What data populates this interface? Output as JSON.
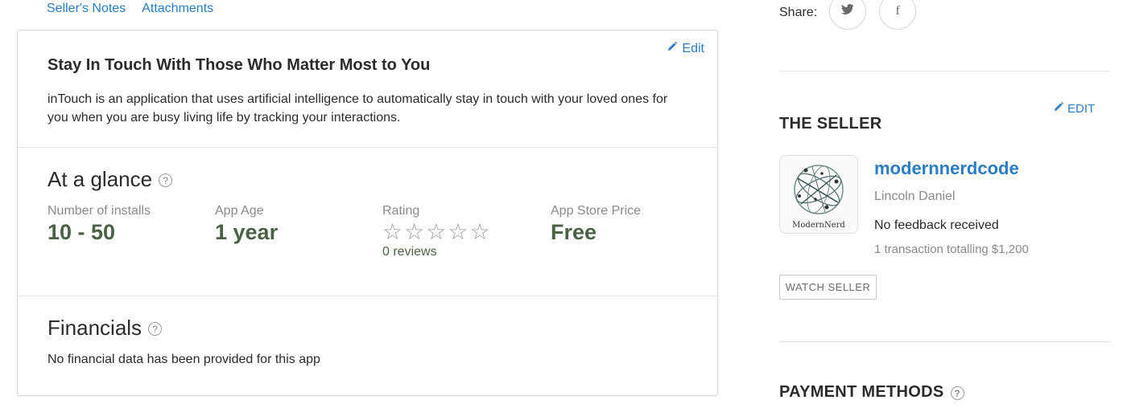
{
  "tabs": [
    {
      "label": "Seller's Notes"
    },
    {
      "label": "Attachments"
    }
  ],
  "about": {
    "edit_label": "Edit",
    "title": "Stay In Touch With Those Who Matter Most to You",
    "description": "inTouch is an application that uses artificial intelligence to automatically stay in touch with your loved ones for you when you are busy living life by tracking your interactions."
  },
  "glance": {
    "heading": "At a glance",
    "help": "?",
    "installs": {
      "label": "Number of installs",
      "value": "10 - 50"
    },
    "app_age": {
      "label": "App Age",
      "value": "1 year"
    },
    "rating": {
      "label": "Rating",
      "stars_filled": 0,
      "stars_total": 5,
      "reviews": "0 reviews"
    },
    "price": {
      "label": "App Store Price",
      "value": "Free"
    }
  },
  "financials": {
    "heading": "Financials",
    "help": "?",
    "text": "No financial data has been provided for this app"
  },
  "share": {
    "label": "Share:",
    "twitter_icon": "twitter-icon",
    "facebook_icon": "facebook-icon",
    "facebook_glyph": "f"
  },
  "seller": {
    "heading": "THE SELLER",
    "edit_label": "EDIT",
    "avatar_caption": "ModernNerd",
    "username": "modernnerdcode",
    "real_name": "Lincoln Daniel",
    "feedback": "No feedback received",
    "transactions": "1 transaction totalling $1,200",
    "watch_label": "WATCH SELLER"
  },
  "payment": {
    "heading": "PAYMENT METHODS",
    "help": "?"
  },
  "colors": {
    "link": "#2a7dc5",
    "value_green": "#4a6244",
    "muted": "#8a8a8a"
  }
}
